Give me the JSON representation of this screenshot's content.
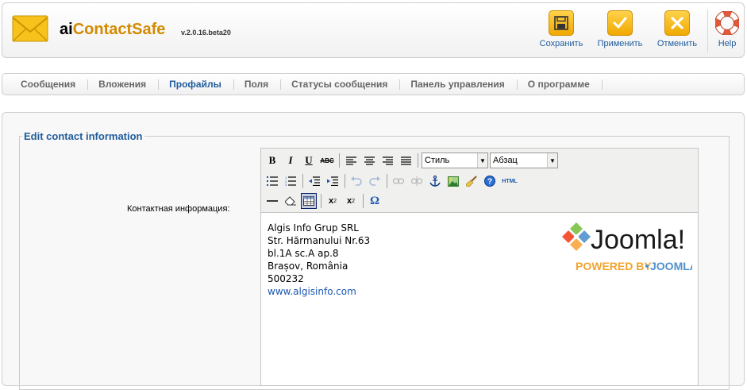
{
  "header": {
    "app_name_a": "ai",
    "app_name_b": "ContactSafe",
    "version": "v.2.0.16.beta20",
    "buttons": {
      "save": "Сохранить",
      "apply": "Применить",
      "cancel": "Отменить",
      "help": "Help"
    }
  },
  "tabs": [
    {
      "label": "Сообщения"
    },
    {
      "label": "Вложения"
    },
    {
      "label": "Профайлы",
      "active": true
    },
    {
      "label": "Поля"
    },
    {
      "label": "Статусы сообщения"
    },
    {
      "label": "Панель управления"
    },
    {
      "label": "О программе"
    }
  ],
  "form": {
    "legend": "Edit contact information",
    "contact_label": "Контактная информация:"
  },
  "editor": {
    "style_select": "Стиль",
    "format_select": "Абзац",
    "html_button": "HTML",
    "content_lines": [
      "Algis Info Grup SRL",
      "Str. Hărmanului Nr.63",
      "bl.1A sc.A ap.8",
      "Brașov, România",
      "500232"
    ],
    "link": "www.algisinfo.com",
    "logo": {
      "word": "Joomla!",
      "powered_by": "POWERED BY",
      "brand": "JOOMLA"
    }
  },
  "colors": {
    "accent_blue": "#1f5c9c",
    "toolbar_orange": "#f0a900",
    "joomla_orange": "#f3a42c"
  }
}
